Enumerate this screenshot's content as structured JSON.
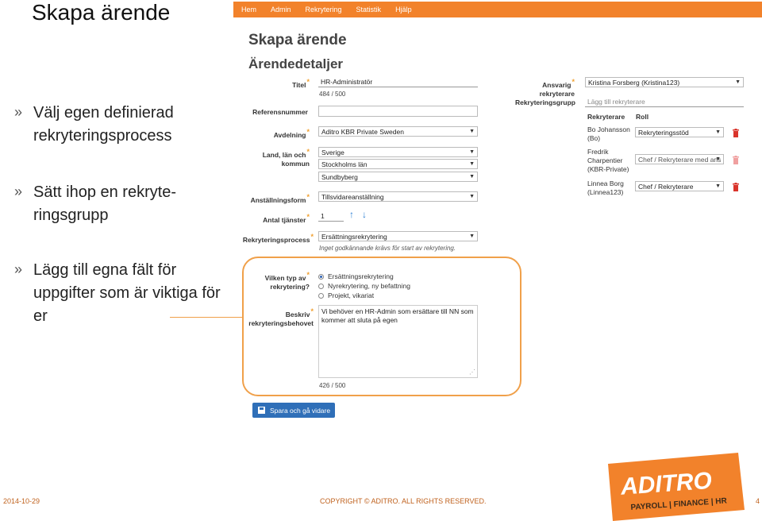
{
  "slide": {
    "title": "Skapa ärende",
    "bullet_mark": "»",
    "bullets": [
      "Välj egen definierad rekryteringsprocess",
      "Sätt ihop en rekryte-ringsgrupp",
      "Lägg till egna fält för uppgifter som är viktiga för er"
    ],
    "footer_date": "2014-10-29",
    "footer_copyright": "COPYRIGHT © ADITRO. ALL RIGHTS RESERVED.",
    "page_number": "4",
    "logo_name": "ADITRO",
    "logo_tagline": "PAYROLL | FINANCE | HR"
  },
  "app": {
    "nav": [
      "Hem",
      "Admin",
      "Rekrytering",
      "Statistik",
      "Hjälp"
    ],
    "heading": "Skapa ärende",
    "section": "Ärendedetaljer",
    "labels": {
      "titel": "Titel",
      "referensnummer": "Referensnummer",
      "avdelning": "Avdelning",
      "land_line1": "Land, län och",
      "land_line2": "kommun",
      "anstallningsform": "Anställningsform",
      "antal_tjanster": "Antal tjänster",
      "rekryteringsprocess": "Rekryteringsprocess",
      "ansvarig_line1": "Ansvarig",
      "ansvarig_line2": "rekryterare",
      "rekryteringsgrupp": "Rekryteringsgrupp",
      "vilken_line1": "Vilken typ av",
      "vilken_line2": "rekrytering?",
      "beskriv_line1": "Beskriv",
      "beskriv_line2": "rekryteringsbehovet"
    },
    "fields": {
      "titel_value": "HR-Administratör",
      "titel_counter": "484 / 500",
      "referensnummer_value": "",
      "avdelning_value": "Aditro KBR Private Sweden",
      "land_value": "Sverige",
      "lan_value": "Stockholms län",
      "kommun_value": "Sundbyberg",
      "anstallningsform_value": "Tillsvidareanställning",
      "antal_tjanster_value": "1",
      "rekryteringsprocess_value": "Ersättningsrekrytering",
      "rekryteringsprocess_hint": "Inget godkännande krävs för start av rekrytering.",
      "ansvarig_value": "Kristina Forsberg (Kristina123)",
      "rekryteringsgrupp_placeholder": "Lägg till rekryterare",
      "beskriv_value": "Vi behöver en HR-Admin som ersättare till NN som kommer att sluta på egen",
      "beskriv_counter": "426 / 500"
    },
    "recruiter_table": {
      "headers": [
        "Rekryterare",
        "Roll"
      ],
      "rows": [
        {
          "name1": "Bo Johansson",
          "name2": "(Bo)",
          "role": "Rekryteringsstöd"
        },
        {
          "name1": "Fredrik",
          "name2": "Charpentier",
          "name3": "(KBR-Private)",
          "role": "Chef / Rekryterare med ans"
        },
        {
          "name1": "Linnea Borg",
          "name2": "(Linnea123)",
          "role": "Chef / Rekryterare"
        }
      ]
    },
    "recruitment_types": [
      "Ersättningsrekrytering",
      "Nyrekrytering, ny befattning",
      "Projekt, vikariat"
    ],
    "selected_type_index": 0,
    "save_button": "Spara och gå vidare",
    "star": "*",
    "up_arrow": "↑",
    "down_arrow": "↓"
  },
  "colors": {
    "accent_orange": "#f2822b",
    "button_blue": "#2f6fb8",
    "trash_red": "#d9342b"
  }
}
